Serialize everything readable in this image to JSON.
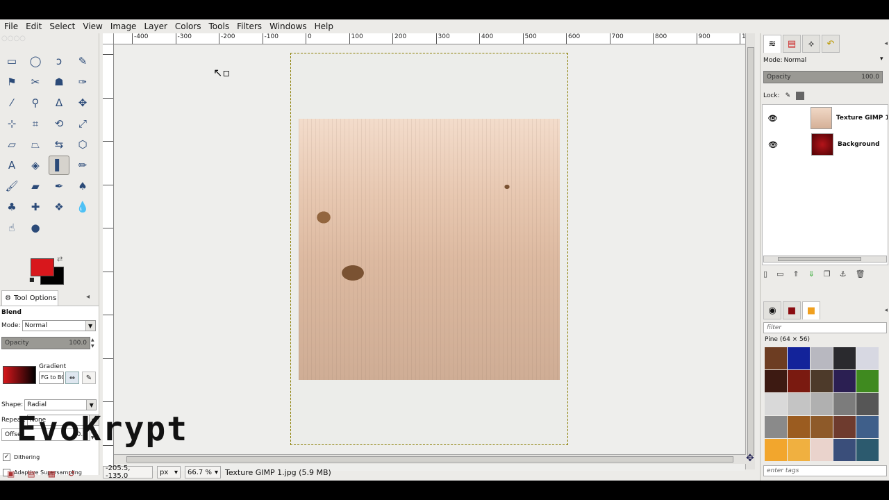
{
  "menu": [
    "File",
    "Edit",
    "Select",
    "View",
    "Image",
    "Layer",
    "Colors",
    "Tools",
    "Filters",
    "Windows",
    "Help"
  ],
  "tools": [
    {
      "name": "rect-select-icon",
      "glyph": "▭"
    },
    {
      "name": "ellipse-select-icon",
      "glyph": "◯"
    },
    {
      "name": "free-select-icon",
      "glyph": "ↄ"
    },
    {
      "name": "fuzzy-select-icon",
      "glyph": "✎"
    },
    {
      "name": "color-select-icon",
      "glyph": "⚑"
    },
    {
      "name": "scissors-icon",
      "glyph": "✂"
    },
    {
      "name": "foreground-select-icon",
      "glyph": "☗"
    },
    {
      "name": "paths-icon",
      "glyph": "✑"
    },
    {
      "name": "color-picker-icon",
      "glyph": "⁄"
    },
    {
      "name": "zoom-icon",
      "glyph": "⚲"
    },
    {
      "name": "measure-icon",
      "glyph": "∆"
    },
    {
      "name": "move-icon",
      "glyph": "✥"
    },
    {
      "name": "align-icon",
      "glyph": "⊹"
    },
    {
      "name": "crop-icon",
      "glyph": "⌗"
    },
    {
      "name": "rotate-icon",
      "glyph": "⟲"
    },
    {
      "name": "scale-icon",
      "glyph": "⤢"
    },
    {
      "name": "shear-icon",
      "glyph": "▱"
    },
    {
      "name": "perspective-icon",
      "glyph": "⏢"
    },
    {
      "name": "flip-icon",
      "glyph": "⇆"
    },
    {
      "name": "cage-transform-icon",
      "glyph": "⬡"
    },
    {
      "name": "text-icon",
      "glyph": "A"
    },
    {
      "name": "bucket-fill-icon",
      "glyph": "◈"
    },
    {
      "name": "blend-icon",
      "glyph": "▌",
      "active": true
    },
    {
      "name": "pencil-icon",
      "glyph": "✏"
    },
    {
      "name": "paintbrush-icon",
      "glyph": "🖌"
    },
    {
      "name": "eraser-icon",
      "glyph": "▰"
    },
    {
      "name": "airbrush-icon",
      "glyph": "✒"
    },
    {
      "name": "ink-icon",
      "glyph": "♠"
    },
    {
      "name": "clone-icon",
      "glyph": "♣"
    },
    {
      "name": "heal-icon",
      "glyph": "✚"
    },
    {
      "name": "perspective-clone-icon",
      "glyph": "❖"
    },
    {
      "name": "blur-icon",
      "glyph": "💧"
    },
    {
      "name": "smudge-icon",
      "glyph": "☝"
    },
    {
      "name": "dodge-burn-icon",
      "glyph": "●"
    }
  ],
  "tool_options": {
    "tab_label": "Tool Options",
    "title": "Blend",
    "mode_label": "Mode:",
    "mode_value": "Normal",
    "opacity_label": "Opacity",
    "opacity_value": "100.0",
    "gradient_label": "Gradient",
    "gradient_value": "FG to BG (RGB)",
    "shape_label": "Shape:",
    "shape_value": "Radial",
    "repeat_label": "Repeat:",
    "repeat_value": "None",
    "offset_label": "Offset",
    "offset_value": "0.0",
    "dithering_label": "Dithering",
    "supersampling_label": "Adaptive Supersampling"
  },
  "colors": {
    "fg": "#d8171c",
    "bg": "#000000"
  },
  "watermark": "EvoKrypt",
  "ruler_labels": [
    "-400",
    "-300",
    "-200",
    "-100",
    "0",
    "100",
    "200",
    "300",
    "400",
    "500",
    "600",
    "700",
    "800",
    "900",
    "100"
  ],
  "status": {
    "coords": "-205.5, -135.0",
    "unit": "px",
    "zoom": "66.7 %",
    "file_info": "Texture GIMP 1.jpg (5.9 MB)"
  },
  "layers_panel": {
    "mode_label": "Mode:",
    "mode_value": "Normal",
    "opacity_label": "Opacity",
    "opacity_value": "100.0",
    "lock_label": "Lock:",
    "layers": [
      {
        "name": "Texture GIMP 1"
      },
      {
        "name": "Background"
      }
    ]
  },
  "patterns_panel": {
    "filter_placeholder": "filter",
    "pattern_name": "Pine (64 × 56)",
    "tags_placeholder": "enter tags",
    "swatch_colors": [
      "#6d3d22",
      "#13239a",
      "#b8b8c0",
      "#2a2a2e",
      "#d7d8e2",
      "#3d1a12",
      "#7a1a10",
      "#4d3a2a",
      "#2b1f52",
      "#3f8a1f",
      "#d9d9d9",
      "#c4c4c4",
      "#b0b0b0",
      "#7c7c7c",
      "#565656",
      "#8a8a8a",
      "#9b5c20",
      "#8e5a29",
      "#6e3b2e",
      "#3f5f8a",
      "#f2a62d",
      "#f0b040",
      "#ead3cc",
      "#3a4e7a",
      "#2c5a6e"
    ]
  }
}
